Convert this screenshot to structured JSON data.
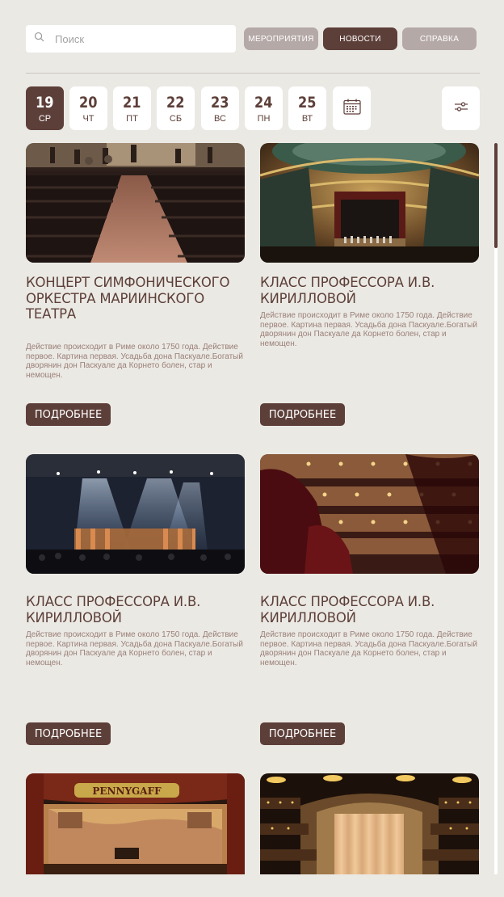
{
  "search": {
    "placeholder": "Поиск"
  },
  "nav": {
    "events": "МЕРОПРИЯТИЯ",
    "news": "НОВОСТИ",
    "help": "СПРАВКА"
  },
  "dates": [
    {
      "num": "19",
      "dow": "СР",
      "active": true
    },
    {
      "num": "20",
      "dow": "ЧТ"
    },
    {
      "num": "21",
      "dow": "ПТ"
    },
    {
      "num": "22",
      "dow": "СБ"
    },
    {
      "num": "23",
      "dow": "ВС"
    },
    {
      "num": "24",
      "dow": "ПН"
    },
    {
      "num": "25",
      "dow": "ВТ"
    }
  ],
  "icons": {
    "search": "search-icon",
    "calendar": "calendar-icon",
    "filter": "filter-sliders-icon"
  },
  "colors": {
    "accent": "#5d3f39",
    "muted": "#b5a9a7",
    "background": "#ebe9e4",
    "desc": "#9a7f78"
  },
  "cards": [
    {
      "title": "КОНЦЕРТ СИМФОНИЧЕСКОГО ОРКЕСТРА МАРИИНСКОГО ТЕАТРА",
      "description": "Действие происходит в Риме около 1750 года. Действие первое. Картина первая. Усадьба дона Паскуале.Богатый дворянин дон Паскуале да Корнето болен, стар и немощен.",
      "button": "ПОДРОБНЕЕ",
      "image": "concert-hall-aisle-photo"
    },
    {
      "title": "КЛАСС ПРОФЕССОРА И.В. КИРИЛЛОВОЙ",
      "description": "Действие происходит в Риме около 1750 года. Действие первое. Картина первая. Усадьба дона Паскуале.Богатый дворянин дон Паскуале да Корнето болен, стар и немощен.",
      "button": "ПОДРОБНЕЕ",
      "image": "opera-house-stage-photo"
    },
    {
      "title": "КЛАСС ПРОФЕССОРА И.В. КИРИЛЛОВОЙ",
      "description": "Действие происходит в Риме около 1750 года. Действие первое. Картина первая. Усадьба дона Паскуале.Богатый дворянин дон Паскуале да Корнето болен, стар и немощен.",
      "button": "ПОДРОБНЕЕ",
      "image": "stage-spotlights-photo"
    },
    {
      "title": "КЛАСС ПРОФЕССОРА И.В. КИРИЛЛОВОЙ",
      "description": "Действие происходит в Риме около 1750 года. Действие первое. Картина первая. Усадьба дона Паскуале.Богатый дворянин дон Паскуале да Корнето болен, стар и немощен.",
      "button": "ПОДРОБНЕЕ",
      "image": "theatre-balconies-photo"
    },
    {
      "image": "pennygaff-curtain-photo",
      "image_text": "PENNYGAFF"
    },
    {
      "image": "theatre-curtain-photo"
    }
  ]
}
